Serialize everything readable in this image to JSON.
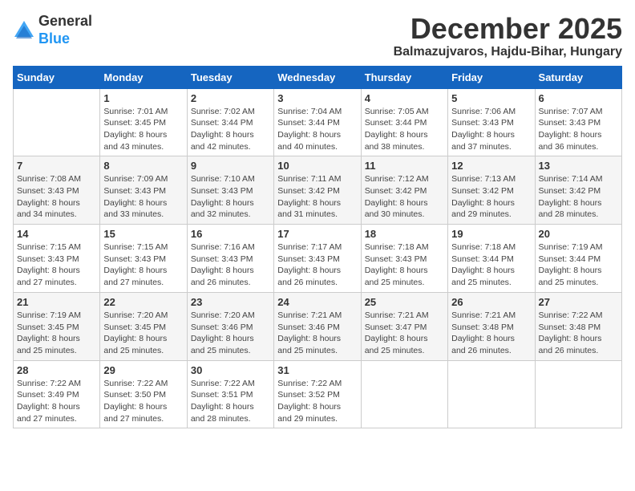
{
  "header": {
    "logo_general": "General",
    "logo_blue": "Blue",
    "month_title": "December 2025",
    "subtitle": "Balmazujvaros, Hajdu-Bihar, Hungary"
  },
  "weekdays": [
    "Sunday",
    "Monday",
    "Tuesday",
    "Wednesday",
    "Thursday",
    "Friday",
    "Saturday"
  ],
  "weeks": [
    [
      {
        "day": "",
        "info": ""
      },
      {
        "day": "1",
        "info": "Sunrise: 7:01 AM\nSunset: 3:45 PM\nDaylight: 8 hours\nand 43 minutes."
      },
      {
        "day": "2",
        "info": "Sunrise: 7:02 AM\nSunset: 3:44 PM\nDaylight: 8 hours\nand 42 minutes."
      },
      {
        "day": "3",
        "info": "Sunrise: 7:04 AM\nSunset: 3:44 PM\nDaylight: 8 hours\nand 40 minutes."
      },
      {
        "day": "4",
        "info": "Sunrise: 7:05 AM\nSunset: 3:44 PM\nDaylight: 8 hours\nand 38 minutes."
      },
      {
        "day": "5",
        "info": "Sunrise: 7:06 AM\nSunset: 3:43 PM\nDaylight: 8 hours\nand 37 minutes."
      },
      {
        "day": "6",
        "info": "Sunrise: 7:07 AM\nSunset: 3:43 PM\nDaylight: 8 hours\nand 36 minutes."
      }
    ],
    [
      {
        "day": "7",
        "info": "Sunrise: 7:08 AM\nSunset: 3:43 PM\nDaylight: 8 hours\nand 34 minutes."
      },
      {
        "day": "8",
        "info": "Sunrise: 7:09 AM\nSunset: 3:43 PM\nDaylight: 8 hours\nand 33 minutes."
      },
      {
        "day": "9",
        "info": "Sunrise: 7:10 AM\nSunset: 3:43 PM\nDaylight: 8 hours\nand 32 minutes."
      },
      {
        "day": "10",
        "info": "Sunrise: 7:11 AM\nSunset: 3:42 PM\nDaylight: 8 hours\nand 31 minutes."
      },
      {
        "day": "11",
        "info": "Sunrise: 7:12 AM\nSunset: 3:42 PM\nDaylight: 8 hours\nand 30 minutes."
      },
      {
        "day": "12",
        "info": "Sunrise: 7:13 AM\nSunset: 3:42 PM\nDaylight: 8 hours\nand 29 minutes."
      },
      {
        "day": "13",
        "info": "Sunrise: 7:14 AM\nSunset: 3:42 PM\nDaylight: 8 hours\nand 28 minutes."
      }
    ],
    [
      {
        "day": "14",
        "info": "Sunrise: 7:15 AM\nSunset: 3:43 PM\nDaylight: 8 hours\nand 27 minutes."
      },
      {
        "day": "15",
        "info": "Sunrise: 7:15 AM\nSunset: 3:43 PM\nDaylight: 8 hours\nand 27 minutes."
      },
      {
        "day": "16",
        "info": "Sunrise: 7:16 AM\nSunset: 3:43 PM\nDaylight: 8 hours\nand 26 minutes."
      },
      {
        "day": "17",
        "info": "Sunrise: 7:17 AM\nSunset: 3:43 PM\nDaylight: 8 hours\nand 26 minutes."
      },
      {
        "day": "18",
        "info": "Sunrise: 7:18 AM\nSunset: 3:43 PM\nDaylight: 8 hours\nand 25 minutes."
      },
      {
        "day": "19",
        "info": "Sunrise: 7:18 AM\nSunset: 3:44 PM\nDaylight: 8 hours\nand 25 minutes."
      },
      {
        "day": "20",
        "info": "Sunrise: 7:19 AM\nSunset: 3:44 PM\nDaylight: 8 hours\nand 25 minutes."
      }
    ],
    [
      {
        "day": "21",
        "info": "Sunrise: 7:19 AM\nSunset: 3:45 PM\nDaylight: 8 hours\nand 25 minutes."
      },
      {
        "day": "22",
        "info": "Sunrise: 7:20 AM\nSunset: 3:45 PM\nDaylight: 8 hours\nand 25 minutes."
      },
      {
        "day": "23",
        "info": "Sunrise: 7:20 AM\nSunset: 3:46 PM\nDaylight: 8 hours\nand 25 minutes."
      },
      {
        "day": "24",
        "info": "Sunrise: 7:21 AM\nSunset: 3:46 PM\nDaylight: 8 hours\nand 25 minutes."
      },
      {
        "day": "25",
        "info": "Sunrise: 7:21 AM\nSunset: 3:47 PM\nDaylight: 8 hours\nand 25 minutes."
      },
      {
        "day": "26",
        "info": "Sunrise: 7:21 AM\nSunset: 3:48 PM\nDaylight: 8 hours\nand 26 minutes."
      },
      {
        "day": "27",
        "info": "Sunrise: 7:22 AM\nSunset: 3:48 PM\nDaylight: 8 hours\nand 26 minutes."
      }
    ],
    [
      {
        "day": "28",
        "info": "Sunrise: 7:22 AM\nSunset: 3:49 PM\nDaylight: 8 hours\nand 27 minutes."
      },
      {
        "day": "29",
        "info": "Sunrise: 7:22 AM\nSunset: 3:50 PM\nDaylight: 8 hours\nand 27 minutes."
      },
      {
        "day": "30",
        "info": "Sunrise: 7:22 AM\nSunset: 3:51 PM\nDaylight: 8 hours\nand 28 minutes."
      },
      {
        "day": "31",
        "info": "Sunrise: 7:22 AM\nSunset: 3:52 PM\nDaylight: 8 hours\nand 29 minutes."
      },
      {
        "day": "",
        "info": ""
      },
      {
        "day": "",
        "info": ""
      },
      {
        "day": "",
        "info": ""
      }
    ]
  ]
}
